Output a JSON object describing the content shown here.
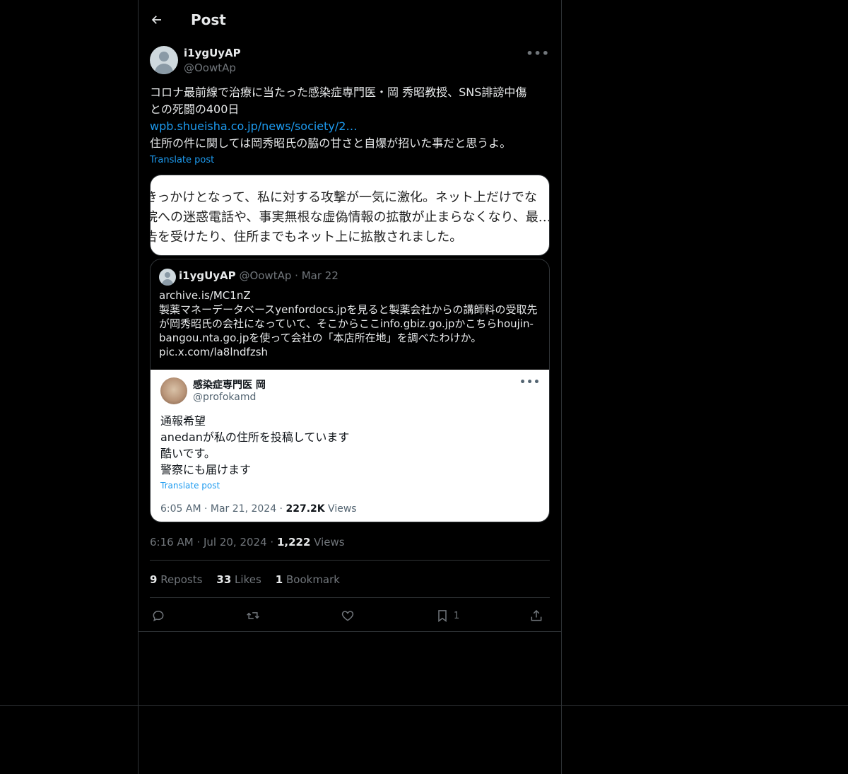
{
  "header": {
    "title": "Post"
  },
  "author": {
    "display_name": "i1ygUyAP",
    "handle": "@OowtAp"
  },
  "tweet": {
    "line1": "コロナ最前線で治療に当たった感染症専門医・岡 秀昭教授、SNS誹謗中傷",
    "line2": "との死闘の400日",
    "link": "wpb.shueisha.co.jp/news/society/2…",
    "line3": "住所の件に関しては岡秀昭氏の脇の甘さと自爆が招いた事だと思うよ。",
    "translate": "Translate post"
  },
  "media": {
    "lines": [
      "きっかけとなって、私に対する攻撃が一気に激化。ネット上だけでな",
      "院への迷惑電話や、事実無根な虚偽情報の拡散が止まらなくなり、最…",
      "告を受けたり、住所までもネット上に拡散されました。"
    ]
  },
  "quote": {
    "display_name": "i1ygUyAP",
    "handle": "@OowtAp",
    "dot": "·",
    "date": "Mar 22",
    "lines": [
      "archive.is/MC1nZ",
      "製薬マネーデータベースyenfordocs.jpを見ると製薬会社からの講師料の受取先",
      "が岡秀昭氏の会社になっていて、そこからここinfo.gbiz.go.jpかこちらhoujin-",
      "bangou.nta.go.jpを使って会社の「本店所在地」を調べたわけか。",
      "pic.x.com/la8lndfzsh"
    ],
    "image": {
      "display_name": "感染症専門医 岡",
      "handle": "@profokamd",
      "lines": [
        "通報希望",
        "anedanが私の住所を投稿しています",
        "酷いです。",
        "警察にも届けます"
      ],
      "translate": "Translate post",
      "footer_time": "6:05 AM · Mar 21, 2024 · ",
      "footer_views_count": "227.2K",
      "footer_views_label": " Views"
    }
  },
  "meta": {
    "time": "6:16 AM",
    "sep1": " · ",
    "date": "Jul 20, 2024",
    "sep2": " · ",
    "views_count": "1,222",
    "views_label": " Views"
  },
  "stats": {
    "reposts_count": "9",
    "reposts_label": " Reposts",
    "likes_count": "33",
    "likes_label": " Likes",
    "bookmarks_count": "1",
    "bookmarks_label": " Bookmark"
  },
  "actions": {
    "bookmark_count": "1"
  },
  "icons": [
    "back-arrow-icon",
    "more-icon",
    "reply-icon",
    "repost-icon",
    "like-icon",
    "bookmark-icon",
    "share-icon"
  ]
}
